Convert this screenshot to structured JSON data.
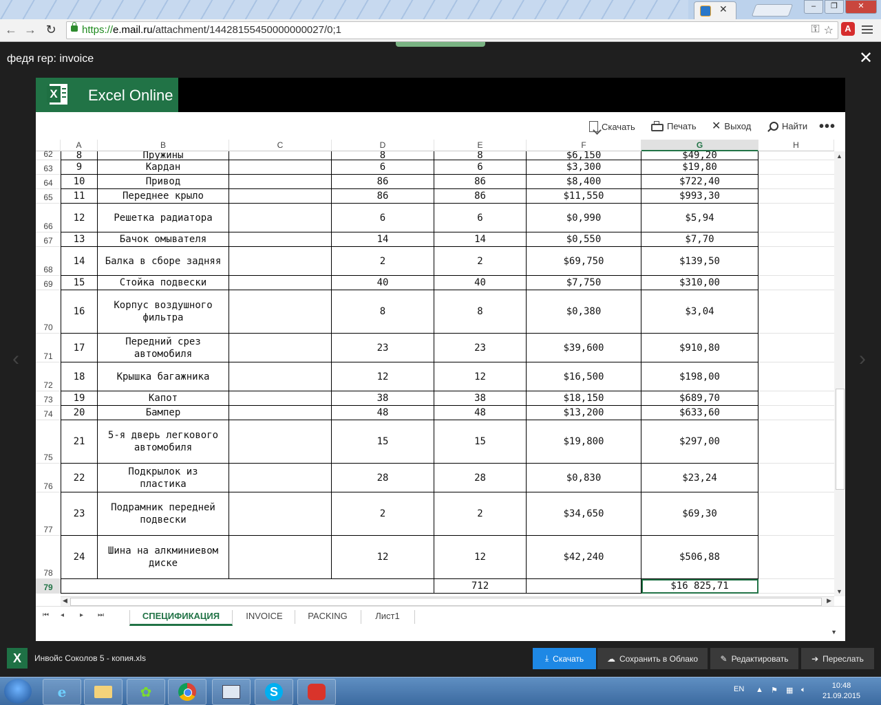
{
  "browser": {
    "url_scheme": "https://",
    "url_host": "e.mail.ru",
    "url_path": "/attachment/14428155450000000027/0;1",
    "ext_label": "A"
  },
  "viewer": {
    "title": "федя гер: invoice",
    "close": "✕",
    "prev_arrow": "‹",
    "next_arrow": "›"
  },
  "excel": {
    "app_name": "Excel Online",
    "logo_letter": "X",
    "commands": {
      "download": "Скачать",
      "print": "Печать",
      "exit": "Выход",
      "find": "Найти",
      "more": "•••"
    },
    "columns": [
      "A",
      "B",
      "C",
      "D",
      "E",
      "F",
      "G",
      "H"
    ],
    "selected_column": "G",
    "rows": [
      {
        "num": "62",
        "a": "8",
        "b": "Пружины",
        "d": "8",
        "e": "8",
        "f": "$6,150",
        "g": "$49,20"
      },
      {
        "num": "63",
        "a": "9",
        "b": "Кардан",
        "d": "6",
        "e": "6",
        "f": "$3,300",
        "g": "$19,80"
      },
      {
        "num": "64",
        "a": "10",
        "b": "Привод",
        "d": "86",
        "e": "86",
        "f": "$8,400",
        "g": "$722,40"
      },
      {
        "num": "65",
        "a": "11",
        "b": "Переднее крыло",
        "d": "86",
        "e": "86",
        "f": "$11,550",
        "g": "$993,30"
      },
      {
        "num": "66",
        "a": "12",
        "b": "Решетка радиатора",
        "d": "6",
        "e": "6",
        "f": "$0,990",
        "g": "$5,94"
      },
      {
        "num": "67",
        "a": "13",
        "b": "Бачок омывателя",
        "d": "14",
        "e": "14",
        "f": "$0,550",
        "g": "$7,70"
      },
      {
        "num": "68",
        "a": "14",
        "b": "Балка в сборе задняя",
        "d": "2",
        "e": "2",
        "f": "$69,750",
        "g": "$139,50"
      },
      {
        "num": "69",
        "a": "15",
        "b": "Стойка подвески",
        "d": "40",
        "e": "40",
        "f": "$7,750",
        "g": "$310,00"
      },
      {
        "num": "70",
        "a": "16",
        "b": "Корпус воздушного\nфильтра",
        "d": "8",
        "e": "8",
        "f": "$0,380",
        "g": "$3,04"
      },
      {
        "num": "71",
        "a": "17",
        "b": "Передний срез\nавтомобиля",
        "d": "23",
        "e": "23",
        "f": "$39,600",
        "g": "$910,80"
      },
      {
        "num": "72",
        "a": "18",
        "b": "Крышка багажника",
        "d": "12",
        "e": "12",
        "f": "$16,500",
        "g": "$198,00"
      },
      {
        "num": "73",
        "a": "19",
        "b": "Капот",
        "d": "38",
        "e": "38",
        "f": "$18,150",
        "g": "$689,70"
      },
      {
        "num": "74",
        "a": "20",
        "b": "Бампер",
        "d": "48",
        "e": "48",
        "f": "$13,200",
        "g": "$633,60"
      },
      {
        "num": "75",
        "a": "21",
        "b": "5-я дверь легкового\nавтомобиля",
        "d": "15",
        "e": "15",
        "f": "$19,800",
        "g": "$297,00"
      },
      {
        "num": "76",
        "a": "22",
        "b": "Подкрылок из\nпластика",
        "d": "28",
        "e": "28",
        "f": "$0,830",
        "g": "$23,24"
      },
      {
        "num": "77",
        "a": "23",
        "b": "Подрамник передней\nподвески",
        "d": "2",
        "e": "2",
        "f": "$34,650",
        "g": "$69,30"
      },
      {
        "num": "78",
        "a": "24",
        "b": "Шина на алкминиевом\nдиске",
        "d": "12",
        "e": "12",
        "f": "$42,240",
        "g": "$506,88"
      }
    ],
    "total_row": {
      "num": "79",
      "e": "712",
      "g": "$16 825,71"
    },
    "sheet_tabs": [
      "СПЕЦИФИКАЦИЯ",
      "INVOICE",
      "PACKING",
      "Лист1"
    ],
    "active_sheet": "СПЕЦИФИКАЦИЯ"
  },
  "footer": {
    "file_icon": "X",
    "filename": "Инвойс Соколов 5 - копия.xls",
    "buttons": {
      "download": "Скачать",
      "save_cloud": "Сохранить в Облако",
      "edit": "Редактировать",
      "forward": "Переслать"
    }
  },
  "taskbar": {
    "lang": "EN",
    "time": "10:48",
    "date": "21.09.2015"
  },
  "colors": {
    "excel_green": "#217346",
    "primary_blue": "#1e88e5"
  }
}
